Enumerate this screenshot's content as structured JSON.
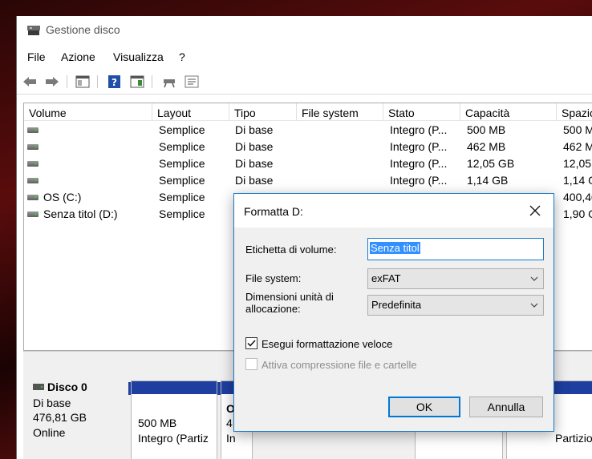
{
  "window": {
    "title": "Gestione disco"
  },
  "menu": [
    "File",
    "Azione",
    "Visualizza",
    "?"
  ],
  "columns": [
    "Volume",
    "Layout",
    "Tipo",
    "File system",
    "Stato",
    "Capacità",
    "Spazio"
  ],
  "volumes": [
    {
      "volume": "",
      "layout": "Semplice",
      "tipo": "Di base",
      "fs": "",
      "stato": "Integro (P...",
      "capacita": "500 MB",
      "spazio": "500 M"
    },
    {
      "volume": "",
      "layout": "Semplice",
      "tipo": "Di base",
      "fs": "",
      "stato": "Integro (P...",
      "capacita": "462 MB",
      "spazio": "462 M"
    },
    {
      "volume": "",
      "layout": "Semplice",
      "tipo": "Di base",
      "fs": "",
      "stato": "Integro (P...",
      "capacita": "12,05 GB",
      "spazio": "12,05"
    },
    {
      "volume": "",
      "layout": "Semplice",
      "tipo": "Di base",
      "fs": "",
      "stato": "Integro (P...",
      "capacita": "1,14 GB",
      "spazio": "1,14 G"
    },
    {
      "volume": "OS (C:)",
      "layout": "Semplice",
      "tipo": "",
      "fs": "",
      "stato": "",
      "capacita": "",
      "spazio": "400,40"
    },
    {
      "volume": "Senza titol (D:)",
      "layout": "Semplice",
      "tipo": "",
      "fs": "",
      "stato": "",
      "capacita": "",
      "spazio": "1,90 G"
    }
  ],
  "disk": {
    "name": "Disco 0",
    "type": "Di base",
    "size": "476,81 GB",
    "status": "Online",
    "partitions": [
      {
        "line1": "500 MB",
        "line2": "Integro (Partiz"
      },
      {
        "line1": "4",
        "line2": "In",
        "head": "O"
      },
      {
        "line1": "",
        "line2": "Partizio"
      }
    ]
  },
  "dialog": {
    "title": "Formatta D:",
    "volume_label_caption": "Etichetta di volume:",
    "volume_label_value": "Senza titol",
    "fs_caption": "File system:",
    "fs_value": "exFAT",
    "alloc_caption_1": "Dimensioni unità di",
    "alloc_caption_2": "allocazione:",
    "alloc_value": "Predefinita",
    "quick_format_label": "Esegui formattazione veloce",
    "quick_format_checked": true,
    "compression_label": "Attiva compressione file e cartelle",
    "compression_checked": false,
    "ok_label": "OK",
    "cancel_label": "Annulla"
  },
  "colors": {
    "partition_bar": "#1f3fa0",
    "accent": "#0078d7"
  }
}
